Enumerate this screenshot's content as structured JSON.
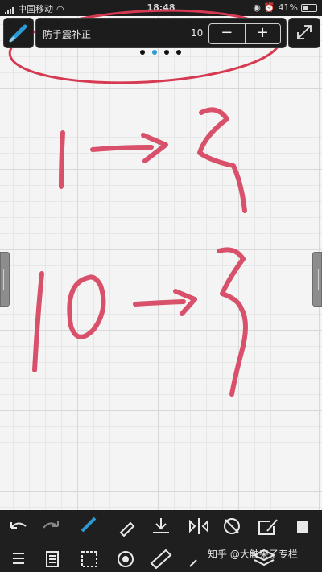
{
  "status_bar": {
    "carrier": "中国移动",
    "time": "18:48",
    "battery": "41%"
  },
  "top_panel": {
    "stabilizer_label": "防手震补正",
    "stabilizer_value": "10",
    "minus_label": "−",
    "plus_label": "+"
  },
  "page_indicator": {
    "count": 4,
    "active_index": 1
  },
  "colors": {
    "ink": "#d8506a",
    "red_circle": "#d63a52",
    "toolbar_bg": "#1f1f1f",
    "accent": "#2a9bd6"
  },
  "toolbar_row1": [
    "undo-icon",
    "redo-icon",
    "brush-icon",
    "eyedropper-icon",
    "download-icon",
    "symmetry-icon",
    "transform-icon",
    "edit-icon",
    "layers-icon"
  ],
  "toolbar_row2": [
    "menu-icon",
    "document-icon",
    "selection-icon",
    "rotate-icon",
    "ruler-icon",
    "pen-icon",
    "layers-icon"
  ],
  "watermark": "知乎 @大触来了专栏"
}
